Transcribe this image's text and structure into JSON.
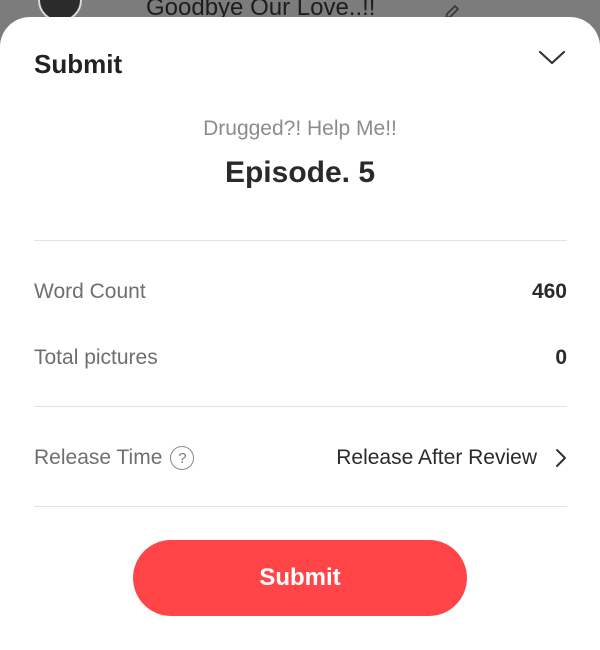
{
  "background": {
    "title": "Goodbye Our Love..!!"
  },
  "sheet": {
    "title": "Submit",
    "series_name": "Drugged?! Help Me!!",
    "episode_title": "Episode. 5"
  },
  "stats": {
    "word_count_label": "Word Count",
    "word_count_value": "460",
    "total_pictures_label": "Total pictures",
    "total_pictures_value": "0"
  },
  "release": {
    "label": "Release Time",
    "help_glyph": "?",
    "value": "Release After Review"
  },
  "submit_button": {
    "label": "Submit",
    "color": "#ff4548"
  },
  "icons": {
    "collapse": "chevron-down-icon",
    "help": "question-circle-icon",
    "release_chevron": "chevron-right-icon",
    "edit": "pencil-icon"
  }
}
